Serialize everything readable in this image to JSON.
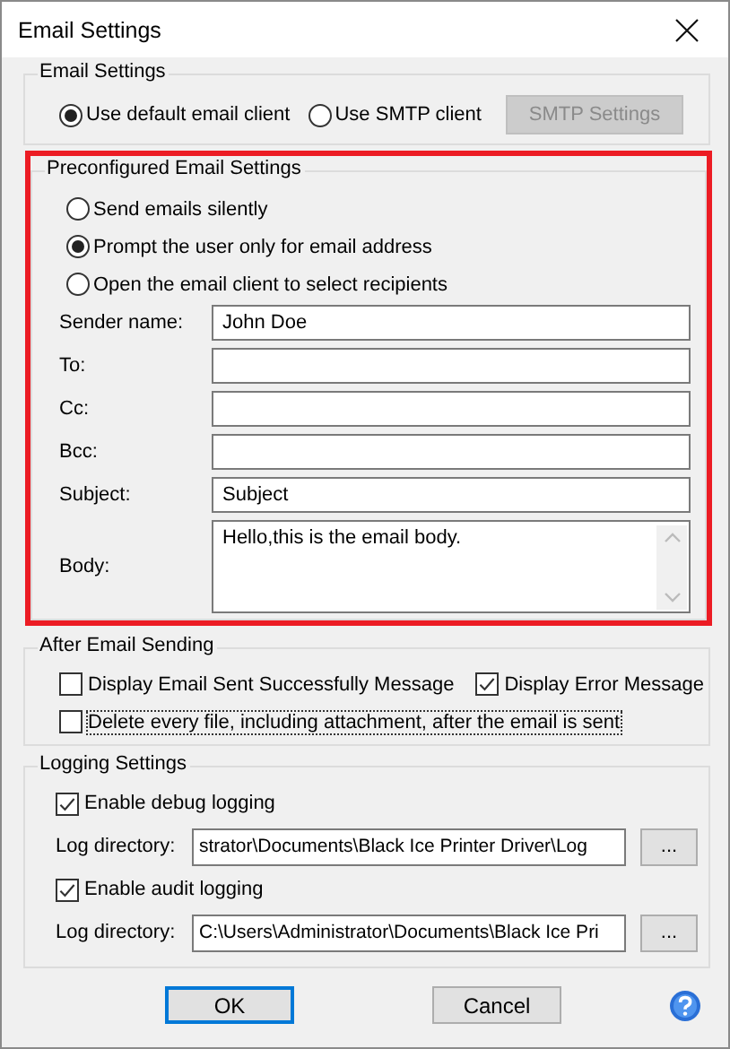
{
  "window": {
    "title": "Email Settings"
  },
  "email_settings": {
    "title": "Email Settings",
    "client_options": [
      {
        "label": "Use default email client",
        "selected": true
      },
      {
        "label": "Use SMTP client",
        "selected": false
      }
    ],
    "smtp_button": {
      "label": "SMTP Settings",
      "disabled": true
    }
  },
  "preconfigured": {
    "title": "Preconfigured Email Settings",
    "highlighted": true,
    "send_modes": [
      {
        "label": "Send emails silently",
        "selected": false
      },
      {
        "label": "Prompt the user only for email address",
        "selected": true
      },
      {
        "label": "Open the email client to select recipients",
        "selected": false
      }
    ],
    "fields": [
      {
        "kind": "line",
        "label": "Sender name:",
        "value": "John Doe"
      },
      {
        "kind": "line",
        "label": "To:"
      },
      {
        "kind": "line",
        "label": "Cc:"
      },
      {
        "kind": "line",
        "label": "Bcc:"
      },
      {
        "kind": "line",
        "label": "Subject:",
        "value": "Subject"
      },
      {
        "kind": "multiline",
        "label": "Body:",
        "value": "Hello,this is the email body."
      }
    ]
  },
  "after_sending": {
    "title": "After Email Sending",
    "options": [
      {
        "label": "Display Email Sent Successfully Message",
        "checked": false,
        "focused": false
      },
      {
        "label": "Display Error Message",
        "checked": true,
        "focused": false
      },
      {
        "label": "Delete every file, including attachment, after the email is sent",
        "checked": false,
        "focused": true
      }
    ]
  },
  "logging": {
    "title": "Logging Settings",
    "sections": [
      {
        "label": "Enable debug logging",
        "checked": true,
        "directory_label": "Log directory:",
        "directory": "strator\\Documents\\Black Ice Printer Driver\\Log",
        "browse_label": "..."
      },
      {
        "label": "Enable audit logging",
        "checked": true,
        "directory_label": "Log directory:",
        "directory": "C:\\Users\\Administrator\\Documents\\Black Ice Pri",
        "browse_label": "..."
      }
    ]
  },
  "buttons": [
    {
      "label": "OK",
      "default": true
    },
    {
      "label": "Cancel",
      "default": false
    }
  ]
}
